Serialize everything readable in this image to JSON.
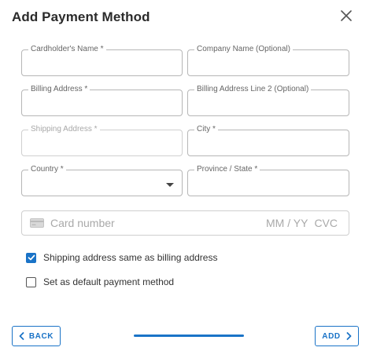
{
  "dialog": {
    "title": "Add Payment Method"
  },
  "fields": {
    "cardholder_name": "Cardholder's Name *",
    "company_name": "Company Name (Optional)",
    "billing_address": "Billing Address *",
    "billing_address_2": "Billing Address Line 2 (Optional)",
    "shipping_address": "Shipping Address *",
    "city": "City *",
    "country": "Country *",
    "province_state": "Province / State *"
  },
  "card": {
    "number_placeholder": "Card number",
    "expiry_placeholder": "MM / YY",
    "cvc_placeholder": "CVC"
  },
  "options": {
    "same_as_billing": {
      "label": "Shipping address same as billing address",
      "checked": true
    },
    "set_default": {
      "label": "Set as default payment method",
      "checked": false
    }
  },
  "footer": {
    "back_label": "BACK",
    "add_label": "ADD"
  },
  "colors": {
    "accent": "#1a73c7"
  },
  "icons": {
    "close": "close-icon",
    "card": "credit-card-icon",
    "back": "chevron-left-icon",
    "add": "chevron-right-icon",
    "dropdown": "caret-down-icon",
    "check": "checkmark-icon"
  }
}
